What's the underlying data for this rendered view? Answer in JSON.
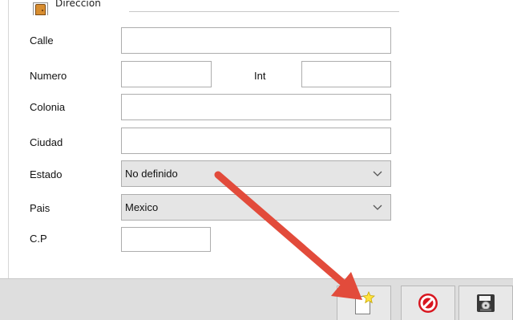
{
  "window": {
    "group_title": "Dirección"
  },
  "form": {
    "fields": {
      "calle": {
        "label": "Calle",
        "value": ""
      },
      "numero": {
        "label": "Numero",
        "value": ""
      },
      "interior": {
        "label": "Int",
        "value": ""
      },
      "colonia": {
        "label": "Colonia",
        "value": ""
      },
      "ciudad": {
        "label": "Ciudad",
        "value": ""
      },
      "estado": {
        "label": "Estado",
        "value": "No definido"
      },
      "pais": {
        "label": "Pais",
        "value": "Mexico"
      },
      "cp": {
        "label": "C.P",
        "value": ""
      }
    }
  },
  "icons": {
    "group": "door-icon",
    "dropdown": "chevron-down-icon",
    "new": "new-document-icon",
    "cancel": "cancel-icon",
    "save": "save-disk-icon"
  },
  "colors": {
    "window_background": "#ffffff",
    "bottom_bar": "#dedede",
    "button_background": "#e8e8e8",
    "field_border": "#adadad",
    "combo_background": "#e5e5e5",
    "annotation_arrow": "#e24b3b",
    "cancel_red": "#d8161f",
    "star_yellow": "#ffe23d"
  }
}
